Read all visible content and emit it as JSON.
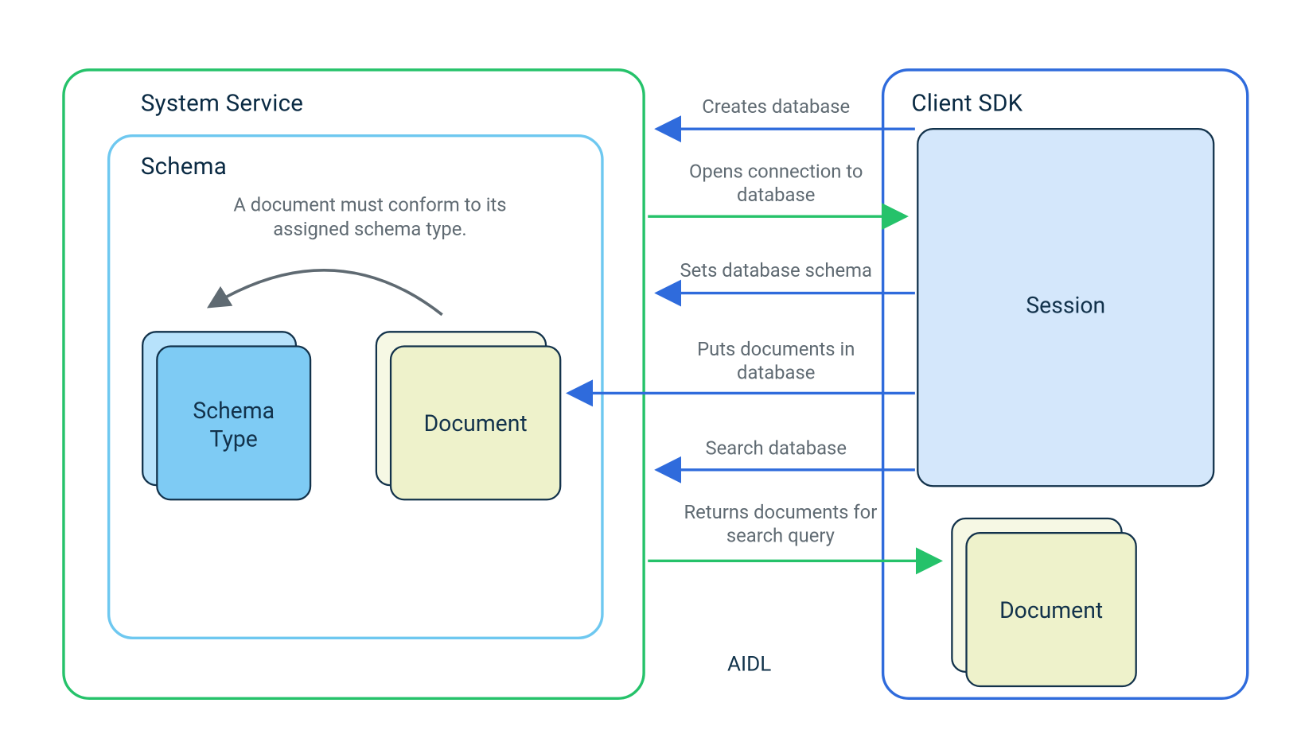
{
  "colors": {
    "system_service_border": "#25c26a",
    "schema_border": "#6ec8f0",
    "client_border": "#2f6bdc",
    "session_fill": "#d4e7fb",
    "session_border": "#12324b",
    "schema_type_fill": "#7ecbf4",
    "schema_type_back": "#b7e2fb",
    "document_fill": "#eef2cb",
    "document_back": "#f6f8e4",
    "card_border": "#12324b",
    "arrow_blue": "#2f6bdc",
    "arrow_green": "#25c26a",
    "curve_gray": "#5f6a72",
    "text_dark": "#0a2a43",
    "text_muted": "#5f6a72"
  },
  "containers": {
    "system_service": "System Service",
    "schema": "Schema",
    "client_sdk": "Client SDK"
  },
  "nodes": {
    "schema_type": "Schema\nType",
    "document": "Document",
    "session": "Session",
    "client_document": "Document"
  },
  "notes": {
    "conform": "A document must conform to its assigned schema type."
  },
  "arrows": {
    "creates_db": "Creates database",
    "opens_conn": "Opens connection to database",
    "sets_schema": "Sets database schema",
    "puts_docs": "Puts documents in database",
    "search_db": "Search database",
    "returns_docs": "Returns documents for search query"
  },
  "footer": {
    "aidl": "AIDL"
  }
}
